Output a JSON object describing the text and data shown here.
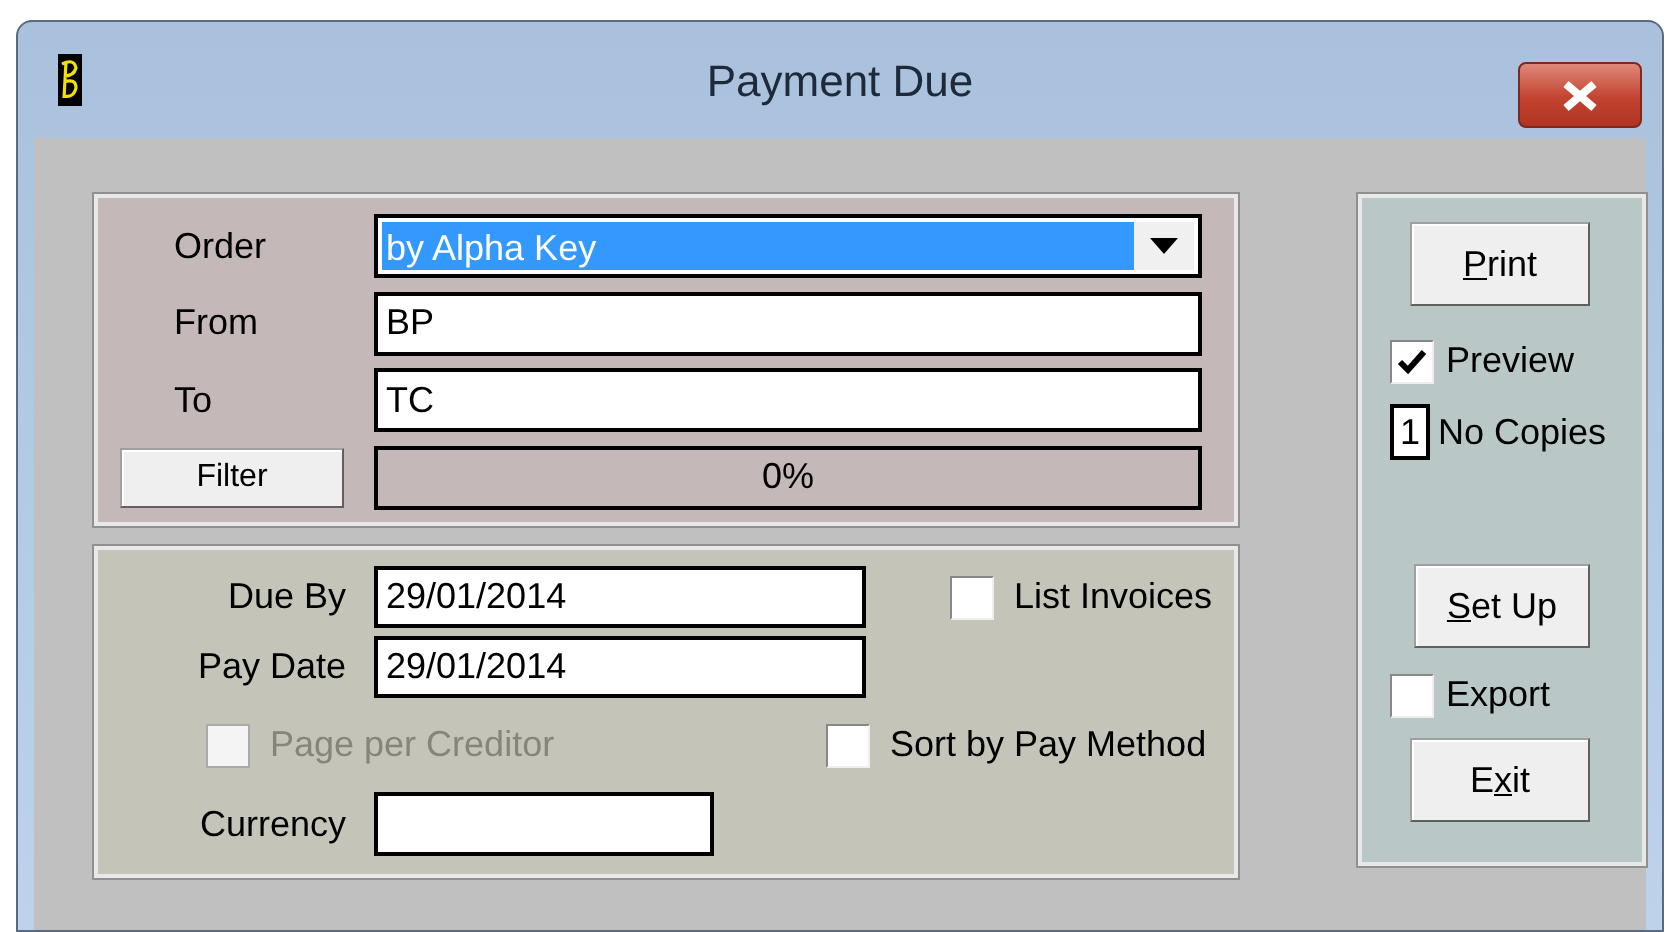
{
  "window": {
    "title": "Payment Due"
  },
  "selection": {
    "order": {
      "label": "Order",
      "value": "by Alpha Key"
    },
    "from": {
      "label": "From",
      "value": "BP"
    },
    "to": {
      "label": "To",
      "value": "TC"
    },
    "filter_button": "Filter",
    "progress": {
      "level": 0,
      "reading": "0%"
    }
  },
  "options": {
    "due_by": {
      "label": "Due By",
      "value": "29/01/2014"
    },
    "pay_date": {
      "label": "Pay Date",
      "value": "29/01/2014"
    },
    "list_invoices": {
      "label": "List Invoices",
      "checked": false
    },
    "page_per_creditor": {
      "label": "Page per Creditor",
      "checked": false,
      "disabled": true
    },
    "sort_by_pay_method": {
      "label": "Sort by Pay Method",
      "checked": false
    },
    "currency": {
      "label": "Currency"
    }
  },
  "actions": {
    "print": {
      "key": "P",
      "after": "rint"
    },
    "preview": {
      "label": "Preview",
      "checked": true
    },
    "copies": {
      "value": "1",
      "label": "No Copies"
    },
    "setup": {
      "key": "S",
      "after": "et Up"
    },
    "export": {
      "label": "Export",
      "checked": false
    },
    "exit": {
      "before": "E",
      "key": "x",
      "after": "it"
    }
  }
}
